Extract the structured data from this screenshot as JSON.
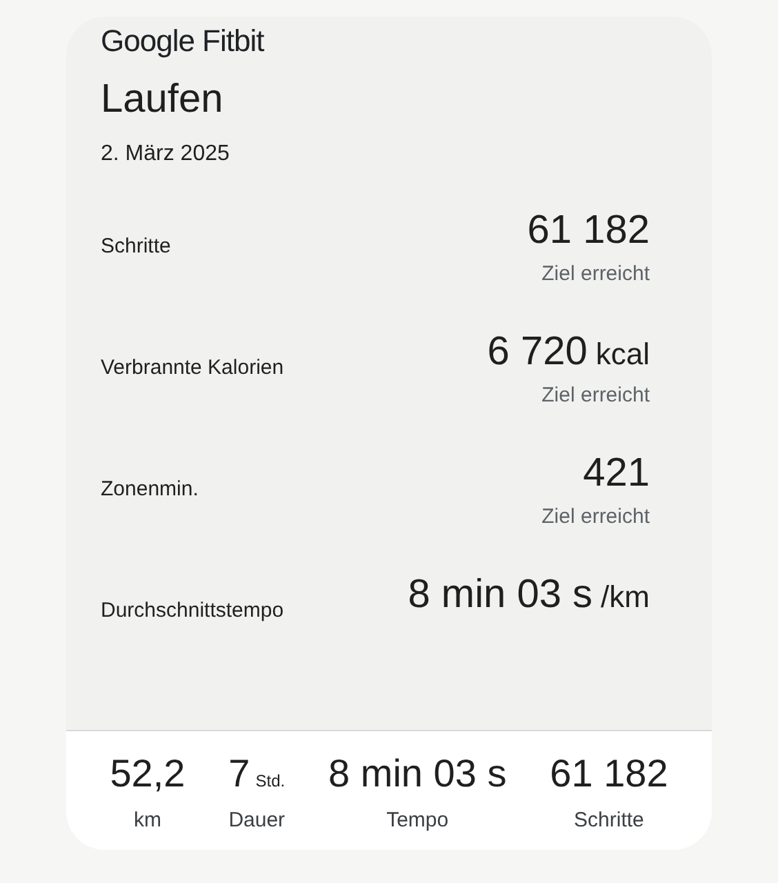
{
  "brand": "Google Fitbit",
  "title": "Laufen",
  "date": "2. März 2025",
  "metrics": [
    {
      "label": "Schritte",
      "value": "61 182",
      "note": "Ziel erreicht"
    },
    {
      "label": "Verbrannte Kalorien",
      "value": "6 720",
      "unit": "kcal",
      "note": "Ziel erreicht"
    },
    {
      "label": "Zonenmin.",
      "value": "421",
      "note": "Ziel erreicht"
    },
    {
      "label": "Durchschnittstempo",
      "value": "8 min 03 s",
      "unit": "/km"
    }
  ],
  "summary": [
    {
      "value": "52,2",
      "label": "km"
    },
    {
      "value": "7",
      "unit": "Std.",
      "label": "Dauer"
    },
    {
      "value": "8 min 03 s",
      "label": "Tempo"
    },
    {
      "value": "61 182",
      "label": "Schritte"
    }
  ]
}
